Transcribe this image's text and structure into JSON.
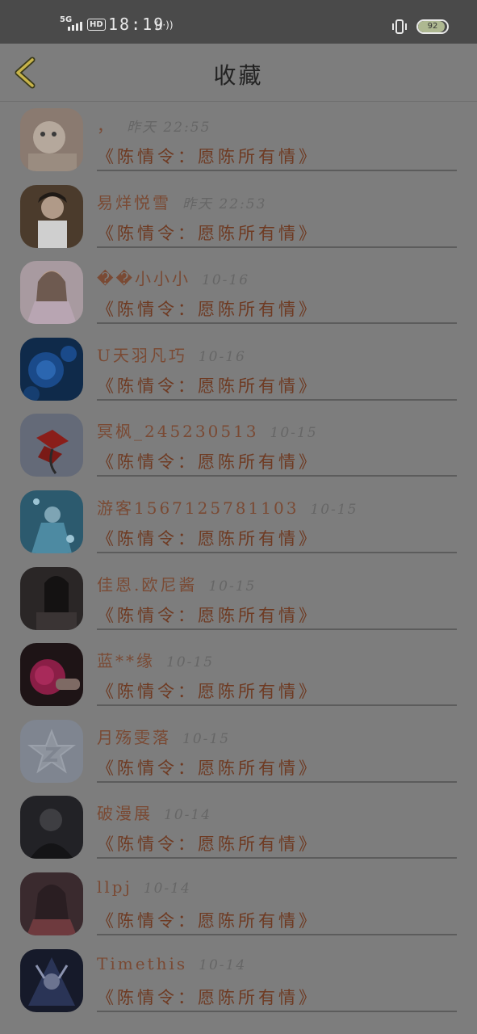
{
  "status_bar": {
    "network": "5G",
    "hd": "HD",
    "time": "18:19",
    "battery": "92",
    "battery_level": 0.92
  },
  "header": {
    "title": "收藏",
    "back_icon": "chevron-left-icon"
  },
  "colors": {
    "background": "#7d7d7d",
    "status_bar": "#4a4a4a",
    "name_text": "#7a4a34",
    "work_text": "#6e3a22",
    "back_icon": "#c8b44a"
  },
  "items": [
    {
      "name": "，",
      "time": "昨天 22:55",
      "work": "《陈情令：愿陈所有情》"
    },
    {
      "name": "易烊悦雪",
      "time": "昨天 22:53",
      "work": "《陈情令：愿陈所有情》"
    },
    {
      "name": "��小小小",
      "time": "10-16",
      "work": "《陈情令：愿陈所有情》"
    },
    {
      "name": "U天羽凡巧",
      "time": "10-16",
      "work": "《陈情令：愿陈所有情》"
    },
    {
      "name": "冥枫_245230513",
      "time": "10-15",
      "work": "《陈情令：愿陈所有情》"
    },
    {
      "name": "游客1567125781103",
      "time": "10-15",
      "work": "《陈情令：愿陈所有情》"
    },
    {
      "name": "佳恩.欧尼酱",
      "time": "10-15",
      "work": "《陈情令：愿陈所有情》"
    },
    {
      "name": "蓝**缘",
      "time": "10-15",
      "work": "《陈情令：愿陈所有情》"
    },
    {
      "name": "月殇雯落",
      "time": "10-15",
      "work": "《陈情令：愿陈所有情》"
    },
    {
      "name": "破漫展",
      "time": "10-14",
      "work": "《陈情令：愿陈所有情》"
    },
    {
      "name": "llpj",
      "time": "10-14",
      "work": "《陈情令：愿陈所有情》"
    },
    {
      "name": "Timethis",
      "time": "10-14",
      "work": "《陈情令：愿陈所有情》"
    }
  ]
}
